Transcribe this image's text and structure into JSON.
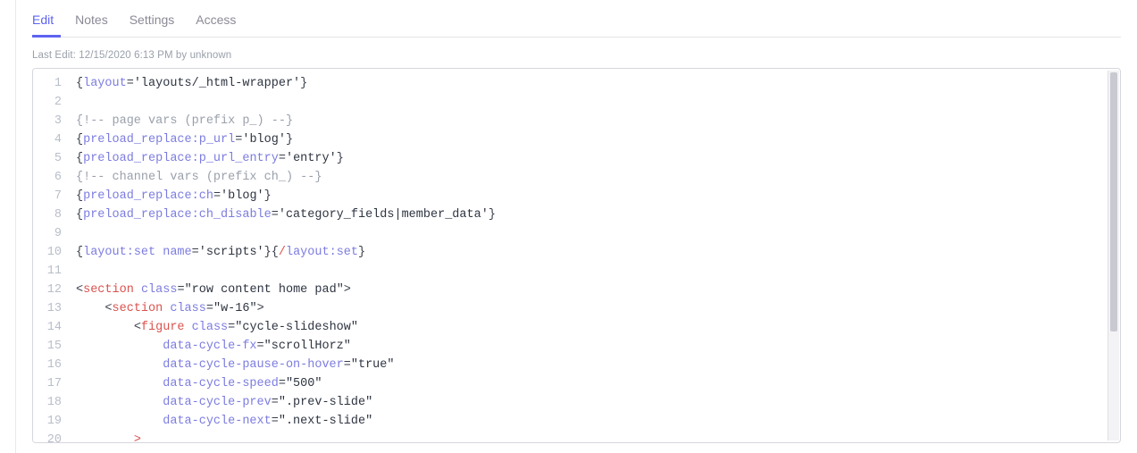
{
  "tabs": [
    {
      "label": "Edit",
      "active": true
    },
    {
      "label": "Notes",
      "active": false
    },
    {
      "label": "Settings",
      "active": false
    },
    {
      "label": "Access",
      "active": false
    }
  ],
  "last_edit_prefix": "Last Edit: ",
  "last_edit_value": "12/15/2020 6:13 PM by unknown",
  "code_lines": [
    {
      "n": 1,
      "tokens": [
        [
          "punc",
          "{"
        ],
        [
          "attr",
          "layout"
        ],
        [
          "op",
          "="
        ],
        [
          "str",
          "'layouts/_html-wrapper'"
        ],
        [
          "punc",
          "}"
        ]
      ]
    },
    {
      "n": 2,
      "tokens": []
    },
    {
      "n": 3,
      "tokens": [
        [
          "comment",
          "{!-- page vars (prefix p_) --}"
        ]
      ]
    },
    {
      "n": 4,
      "tokens": [
        [
          "punc",
          "{"
        ],
        [
          "attr",
          "preload_replace:p_url"
        ],
        [
          "op",
          "="
        ],
        [
          "str",
          "'blog'"
        ],
        [
          "punc",
          "}"
        ]
      ]
    },
    {
      "n": 5,
      "tokens": [
        [
          "punc",
          "{"
        ],
        [
          "attr",
          "preload_replace:p_url_entry"
        ],
        [
          "op",
          "="
        ],
        [
          "str",
          "'entry'"
        ],
        [
          "punc",
          "}"
        ]
      ]
    },
    {
      "n": 6,
      "tokens": [
        [
          "comment",
          "{!-- channel vars (prefix ch_) --}"
        ]
      ]
    },
    {
      "n": 7,
      "tokens": [
        [
          "punc",
          "{"
        ],
        [
          "attr",
          "preload_replace:ch"
        ],
        [
          "op",
          "="
        ],
        [
          "str",
          "'blog'"
        ],
        [
          "punc",
          "}"
        ]
      ]
    },
    {
      "n": 8,
      "tokens": [
        [
          "punc",
          "{"
        ],
        [
          "attr",
          "preload_replace:ch_disable"
        ],
        [
          "op",
          "="
        ],
        [
          "str",
          "'category_fields|member_data'"
        ],
        [
          "punc",
          "}"
        ]
      ]
    },
    {
      "n": 9,
      "tokens": []
    },
    {
      "n": 10,
      "tokens": [
        [
          "punc",
          "{"
        ],
        [
          "attr",
          "layout:set"
        ],
        [
          "plain",
          " "
        ],
        [
          "attr",
          "name"
        ],
        [
          "op",
          "="
        ],
        [
          "str",
          "'scripts'"
        ],
        [
          "punc",
          "}{"
        ],
        [
          "slash",
          "/"
        ],
        [
          "attr",
          "layout:set"
        ],
        [
          "punc",
          "}"
        ]
      ]
    },
    {
      "n": 11,
      "tokens": []
    },
    {
      "n": 12,
      "tokens": [
        [
          "punc",
          "<"
        ],
        [
          "tag",
          "section"
        ],
        [
          "plain",
          " "
        ],
        [
          "attr",
          "class"
        ],
        [
          "op",
          "="
        ],
        [
          "str",
          "\"row content home pad\""
        ],
        [
          "punc",
          ">"
        ]
      ]
    },
    {
      "n": 13,
      "tokens": [
        [
          "plain",
          "    "
        ],
        [
          "punc",
          "<"
        ],
        [
          "tag",
          "section"
        ],
        [
          "plain",
          " "
        ],
        [
          "attr",
          "class"
        ],
        [
          "op",
          "="
        ],
        [
          "str",
          "\"w-16\""
        ],
        [
          "punc",
          ">"
        ]
      ]
    },
    {
      "n": 14,
      "tokens": [
        [
          "plain",
          "        "
        ],
        [
          "punc",
          "<"
        ],
        [
          "tag",
          "figure"
        ],
        [
          "plain",
          " "
        ],
        [
          "attr",
          "class"
        ],
        [
          "op",
          "="
        ],
        [
          "str",
          "\"cycle-slideshow\""
        ]
      ]
    },
    {
      "n": 15,
      "tokens": [
        [
          "plain",
          "            "
        ],
        [
          "attr",
          "data-cycle-fx"
        ],
        [
          "op",
          "="
        ],
        [
          "str",
          "\"scrollHorz\""
        ]
      ]
    },
    {
      "n": 16,
      "tokens": [
        [
          "plain",
          "            "
        ],
        [
          "attr",
          "data-cycle-pause-on-hover"
        ],
        [
          "op",
          "="
        ],
        [
          "str",
          "\"true\""
        ]
      ]
    },
    {
      "n": 17,
      "tokens": [
        [
          "plain",
          "            "
        ],
        [
          "attr",
          "data-cycle-speed"
        ],
        [
          "op",
          "="
        ],
        [
          "str",
          "\"500\""
        ]
      ]
    },
    {
      "n": 18,
      "tokens": [
        [
          "plain",
          "            "
        ],
        [
          "attr",
          "data-cycle-prev"
        ],
        [
          "op",
          "="
        ],
        [
          "str",
          "\".prev-slide\""
        ]
      ]
    },
    {
      "n": 19,
      "tokens": [
        [
          "plain",
          "            "
        ],
        [
          "attr",
          "data-cycle-next"
        ],
        [
          "op",
          "="
        ],
        [
          "str",
          "\".next-slide\""
        ]
      ]
    },
    {
      "n": 20,
      "tokens": [
        [
          "plain",
          "        "
        ],
        [
          "tag",
          ">"
        ]
      ]
    }
  ]
}
